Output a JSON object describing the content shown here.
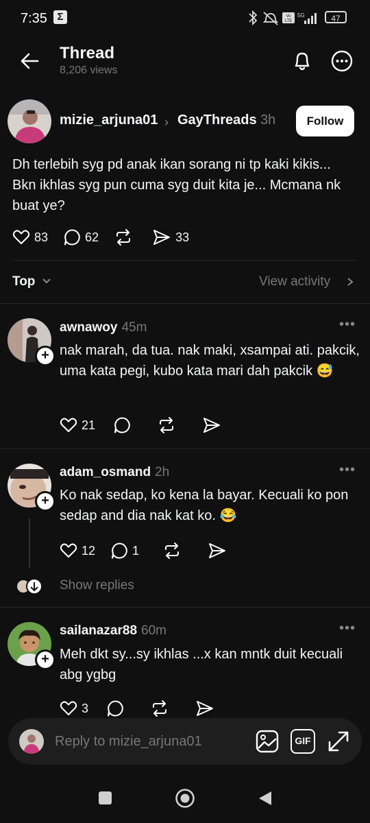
{
  "status_bar": {
    "time": "7:35",
    "notif_glyph": "Σ",
    "battery": "47"
  },
  "header": {
    "title": "Thread",
    "views": "8,206 views"
  },
  "post": {
    "username": "mizie_arjuna01",
    "community": "GayThreads",
    "time": "3h",
    "follow_label": "Follow",
    "text": "Dh terlebih syg pd anak ikan sorang ni tp kaki kikis... Bkn ikhlas syg pun cuma syg duit kita je... Mcmana nk buat ye?",
    "likes": "83",
    "replies": "62",
    "shares": "33"
  },
  "sort": {
    "label": "Top",
    "view_activity": "View activity"
  },
  "comments": [
    {
      "username": "awnawoy",
      "time": "45m",
      "text": "nak marah, da tua. nak maki, xsampai ati. pakcik, uma kata pegi, kubo kata mari dah pakcik 😅",
      "likes": "21",
      "replies": ""
    },
    {
      "username": "adam_osmand",
      "time": "2h",
      "text": "Ko nak sedap, ko kena la bayar. Kecuali ko pon sedap and dia nak kat ko. 😂",
      "likes": "12",
      "replies": "1",
      "show_replies": "Show replies"
    },
    {
      "username": "sailanazar88",
      "time": "60m",
      "text": "Meh dkt sy...sy ikhlas ...x kan mntk duit kecuali abg ygbg",
      "likes": "3",
      "replies": ""
    }
  ],
  "reply_bar": {
    "placeholder": "Reply to mizie_arjuna01",
    "gif_label": "GIF"
  },
  "icons": [
    "back-arrow-icon",
    "bell-icon",
    "more-icon",
    "heart-icon",
    "comment-icon",
    "repost-icon",
    "share-icon",
    "image-icon",
    "gif-icon",
    "expand-icon"
  ]
}
